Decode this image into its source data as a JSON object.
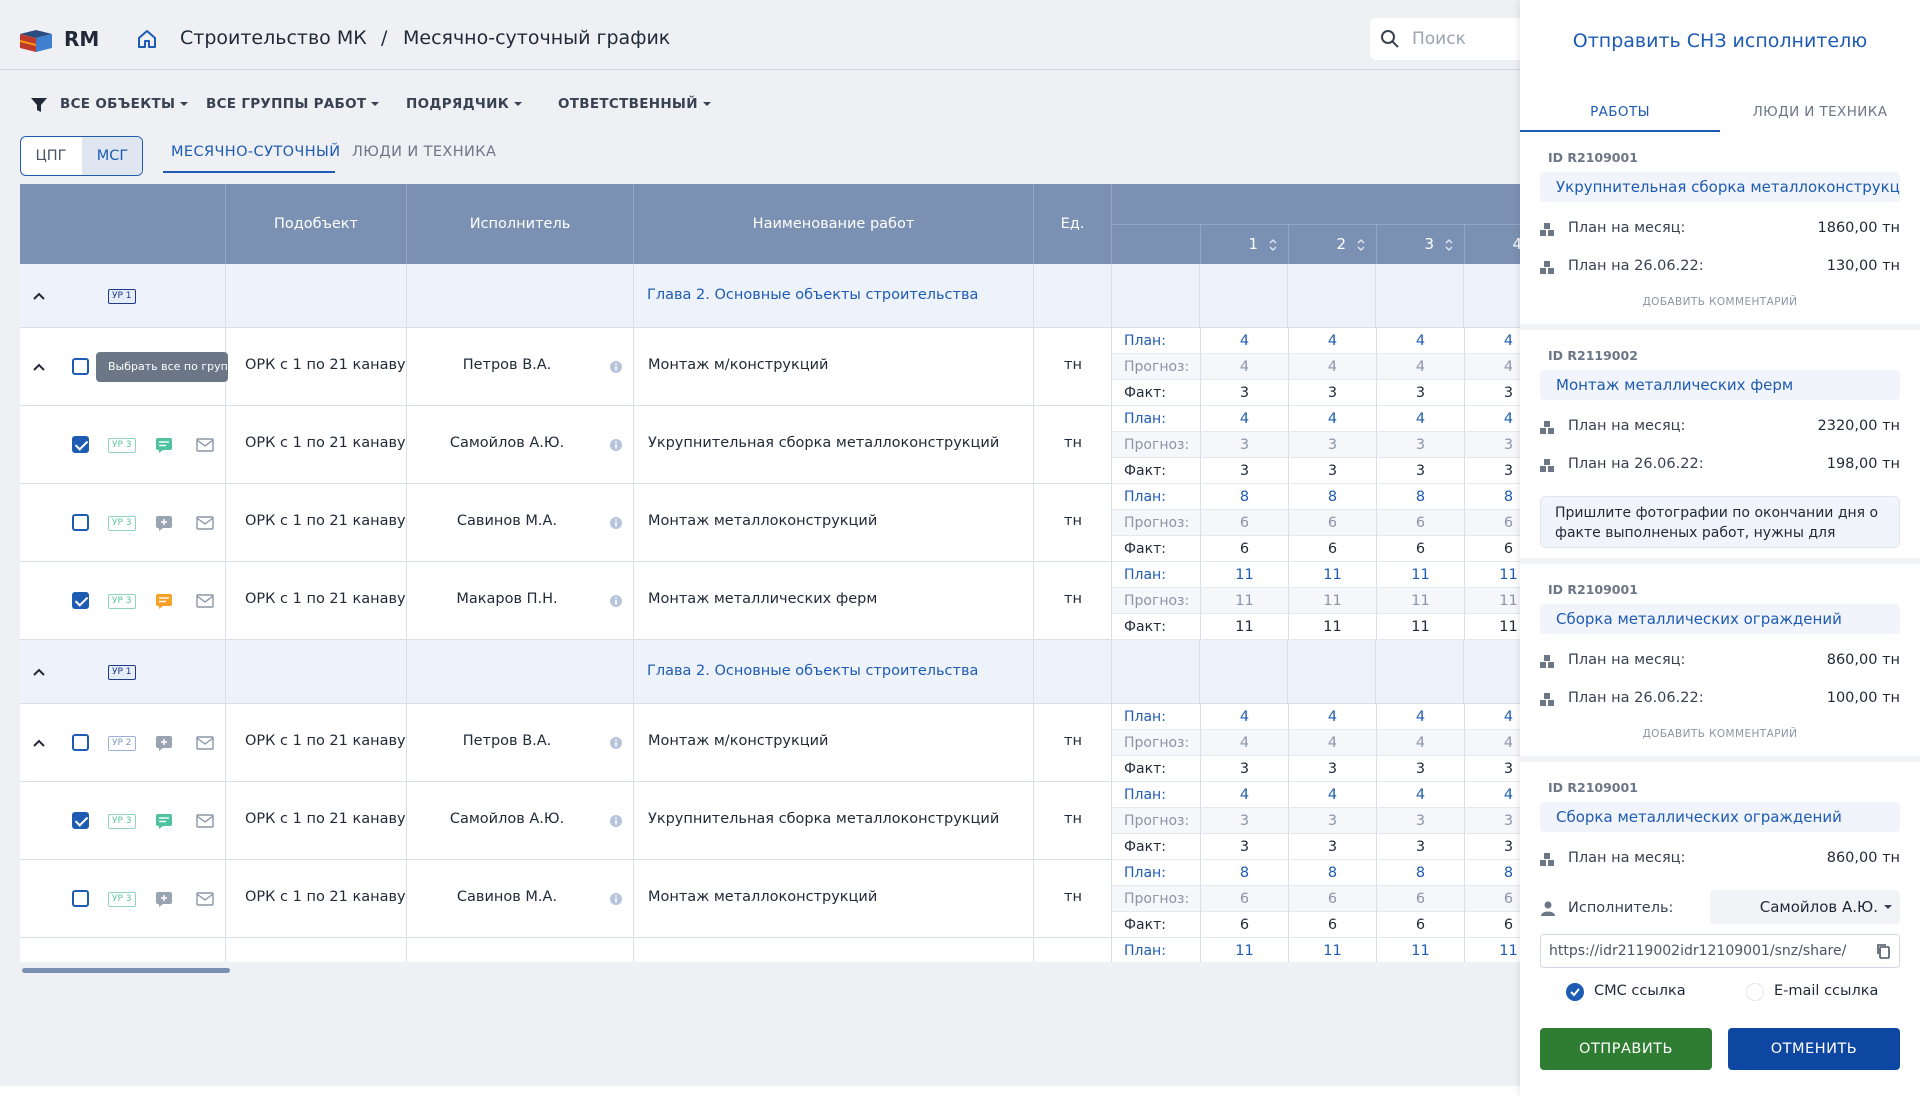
{
  "app": {
    "name": "RM",
    "brand_color": "#1e5bb3"
  },
  "breadcrumb": {
    "root": "Строительство МК",
    "separator": "/",
    "current": "Месячно-суточный график"
  },
  "search": {
    "placeholder": "Поиск"
  },
  "filters": [
    "ВСЕ ОБЪЕКТЫ",
    "ВСЕ ГРУППЫ РАБОТ",
    "ПОДРЯДЧИК",
    "ОТВЕТСТВЕННЫЙ"
  ],
  "view_toggle": {
    "left": "ЦПГ",
    "right": "МСГ",
    "active": "МСГ"
  },
  "tabs": {
    "monthly": "МЕСЯЧНО-СУТОЧНЫЙ",
    "people": "ЛЮДИ И ТЕХНИКА",
    "active": "monthly"
  },
  "table": {
    "headers": {
      "subobject": "Подобъект",
      "executor": "Исполнитель",
      "work_name": "Наименование работ",
      "unit": "Ед."
    },
    "days": [
      "1",
      "2",
      "3",
      "4"
    ],
    "labels": {
      "plan": "План:",
      "forecast": "Прогноз:",
      "fact": "Факт:"
    },
    "tooltip": "Выбрать все по группе",
    "rows": [
      {
        "kind": "group",
        "badge": "УР 1",
        "chapter": "Глава 2. Основные объекты строительства"
      },
      {
        "kind": "work",
        "level": "l2",
        "badge": "УР 2",
        "expand": true,
        "checked": false,
        "icon": "none",
        "subobject": "ОРК с 1 по 21 канаву",
        "executor": "Петров В.А.",
        "work": "Монтаж м/конструкций",
        "unit": "тн",
        "plan": "4",
        "forecast": "4",
        "fact": "3"
      },
      {
        "kind": "work",
        "level": "l3",
        "badge": "УР 3",
        "checked": true,
        "icon": "comment-green",
        "subobject": "ОРК с 1 по 21 канаву",
        "executor": "Самойлов А.Ю.",
        "work": "Укрупнительная сборка металлоконструкций",
        "unit": "тн",
        "plan": "4",
        "forecast": "3",
        "fact": "3"
      },
      {
        "kind": "work",
        "level": "l3",
        "badge": "УР 3",
        "checked": false,
        "icon": "add-gray",
        "subobject": "ОРК с 1 по 21 канаву",
        "executor": "Савинов М.А.",
        "work": "Монтаж металлоконструкций",
        "unit": "тн",
        "plan": "8",
        "forecast": "6",
        "fact": "6"
      },
      {
        "kind": "work",
        "level": "l3",
        "badge": "УР 3",
        "checked": true,
        "icon": "comment-orange",
        "subobject": "ОРК с 1 по 21 канаву",
        "executor": "Макаров П.Н.",
        "work": "Монтаж металлических ферм",
        "unit": "тн",
        "plan": "11",
        "forecast": "11",
        "fact": "11"
      },
      {
        "kind": "group",
        "badge": "УР 1",
        "chapter": "Глава 2. Основные объекты строительства"
      },
      {
        "kind": "work",
        "level": "l2",
        "badge": "УР 2",
        "expand": true,
        "checked": false,
        "icon": "add-gray",
        "subobject": "ОРК с 1 по 21 канаву",
        "executor": "Петров В.А.",
        "work": "Монтаж м/конструкций",
        "unit": "тн",
        "plan": "4",
        "forecast": "4",
        "fact": "3"
      },
      {
        "kind": "work",
        "level": "l3",
        "badge": "УР 3",
        "checked": true,
        "icon": "comment-green",
        "subobject": "ОРК с 1 по 21 канаву",
        "executor": "Самойлов А.Ю.",
        "work": "Укрупнительная сборка металлоконструкций",
        "unit": "тн",
        "plan": "4",
        "forecast": "3",
        "fact": "3"
      },
      {
        "kind": "work",
        "level": "l3",
        "badge": "УР 3",
        "checked": false,
        "icon": "add-gray",
        "subobject": "ОРК с 1 по 21 канаву",
        "executor": "Савинов М.А.",
        "work": "Монтаж металлоконструкций",
        "unit": "тн",
        "plan": "8",
        "forecast": "6",
        "fact": "6"
      },
      {
        "kind": "partial",
        "plan": "11"
      }
    ]
  },
  "panel": {
    "title": "Отправить СНЗ исполнителю",
    "tabs": {
      "works": "РАБОТЫ",
      "people": "ЛЮДИ И ТЕХНИКА",
      "active": "works"
    },
    "cards": [
      {
        "id": "ID R2109001",
        "name": "Укрупнительная сборка металлоконструкций",
        "month_label": "План на месяц:",
        "month_value": "1860,00 тн",
        "day_label": "План на 26.06.22:",
        "day_value": "130,00 тн",
        "comment": "",
        "add_comment": "ДОБАВИТЬ КОММЕНТАРИЙ"
      },
      {
        "id": "ID R2119002",
        "name": "Монтаж металлических ферм",
        "month_label": "План на месяц:",
        "month_value": "2320,00 тн",
        "day_label": "План на 26.06.22:",
        "day_value": "198,00 тн",
        "comment": "Пришлите фотографии по окончании дня о факте выполненых работ, нужны для отчета",
        "add_comment": ""
      },
      {
        "id": "ID R2109001",
        "name": "Сборка металлических ограждений",
        "month_label": "План на месяц:",
        "month_value": "860,00 тн",
        "day_label": "План на 26.06.22:",
        "day_value": "100,00 тн",
        "comment": "",
        "add_comment": "ДОБАВИТЬ КОММЕНТАРИЙ"
      },
      {
        "id": "ID R2109001",
        "name": "Сборка металлических ограждений",
        "month_label": "План на месяц:",
        "month_value": "860,00 тн",
        "day_label": "",
        "day_value": "",
        "comment": "",
        "add_comment": ""
      }
    ],
    "executor_label": "Исполнитель:",
    "executor_value": "Самойлов А.Ю.",
    "link": "https://idr2119002idr12109001/snz/share/",
    "sms_label": "СМС ссылка",
    "sms_checked": true,
    "email_label": "E-mail ссылка",
    "email_checked": false,
    "send_label": "ОТПРАВИТЬ",
    "cancel_label": "ОТМЕНИТЬ",
    "send_color": "#2e7d32",
    "cancel_color": "#0d47a1"
  }
}
